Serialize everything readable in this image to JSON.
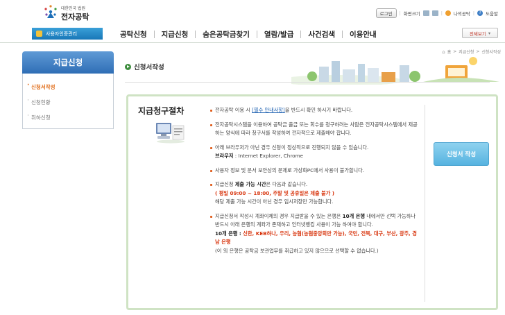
{
  "header": {
    "logo_small": "대한민국 법원",
    "logo_big": "전자공탁",
    "login": "로그인",
    "font_size_label": "화면크기",
    "my_deposit": "나의공탁",
    "help": "도움말"
  },
  "nav": {
    "cert_label": "사용자인증관리",
    "menu": [
      "공탁신청",
      "지급신청",
      "숨은공탁금찾기",
      "열람/발급",
      "사건검색",
      "이용안내"
    ],
    "all_view": "전체보기"
  },
  "sidebar": {
    "title": "지급신청",
    "items": [
      "신청서작성",
      "신청현황",
      "취하신청"
    ]
  },
  "page": {
    "title": "신청서작성",
    "breadcrumb": [
      "홈",
      ">",
      "지급신청",
      ">",
      "신청서작성"
    ]
  },
  "procedure": {
    "title": "지급청구절차",
    "apply_button": "신청서 작성",
    "n1_pre": "전자공탁 이용 시 ",
    "n1_link": "[필수 안내사항]",
    "n1_post": "을 반드시 확인 하시기 바랍니다.",
    "n2": "전자공탁시스템을 이용하여 공탁금 출급 또는 회수를 청구하려는 사람은 전자공탁시스템에서 제공하는 양식에 따라 청구서를 작성하여 전자적으로 제출해야 합니다.",
    "n3_a": "아래 브라우저가 아닌 경우 신청이 정상적으로 진행되지 않을 수 있습니다.",
    "n3_b_label": "브라우저",
    "n3_b_value": " : Internet Explorer, Chrome",
    "n4": "사용자 정보 및 문서 보안상의 문제로 가상화PC에서 사용이 불가합니다.",
    "n5_a_pre": "지급신청 ",
    "n5_a_bold": "제출 가능 시간",
    "n5_a_post": "은 다음과 같습니다.",
    "n5_b": "( 평일 09:00 ~ 18:00, 주말 및 공휴일은 제출 불가 )",
    "n5_c": "해당 제출 가능 시간이 아닌 경우 임시저장만 가능합니다.",
    "n6_a_pre": "지급신청서 작성시 계좌이체의 경우 지급받을 수 있는 은행은 ",
    "n6_a_bold": "10개 은행",
    "n6_a_post": " 내에서만 선택 가능하나 반드시 아래 은행의 계좌가 존재하고 인터넷뱅킹 사용이 가능 하여야 합니다.",
    "n6_b_label": "10개 은행 : ",
    "n6_b_banks": "신한, KEB하나, 우리, 농협(농협중앙회만 가능), 국민, 전북, 대구, 부산, 광주, 경남 은행",
    "n6_c": "(이 외 은행은 공탁금 보관업무를 취급하고 있지 않으므로 선택할 수 없습니다.)"
  }
}
